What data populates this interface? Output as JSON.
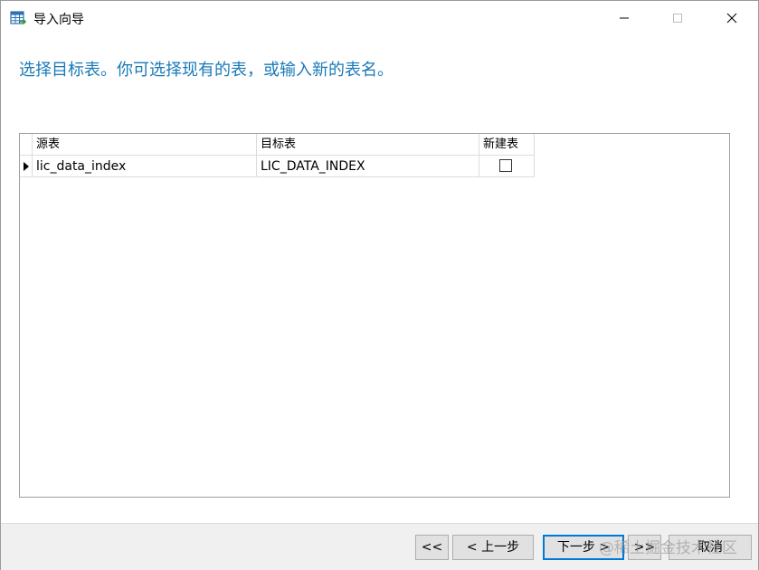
{
  "window": {
    "title": "导入向导",
    "icon": "table-import-icon"
  },
  "heading": "选择目标表。你可选择现有的表，或输入新的表名。",
  "grid": {
    "headers": {
      "source": "源表",
      "target": "目标表",
      "new_table": "新建表"
    },
    "rows": [
      {
        "source": "lic_data_index",
        "target": "LIC_DATA_INDEX",
        "new_table": false
      }
    ]
  },
  "footer": {
    "first_label": "<<",
    "prev_label": "< 上一步",
    "next_label": "下一步 >",
    "last_label": ">>",
    "cancel_label": "取消",
    "watermark": "@稀土掘金技术社区"
  },
  "colors": {
    "heading": "#1a7ab8",
    "focus_border": "#0078d7"
  }
}
